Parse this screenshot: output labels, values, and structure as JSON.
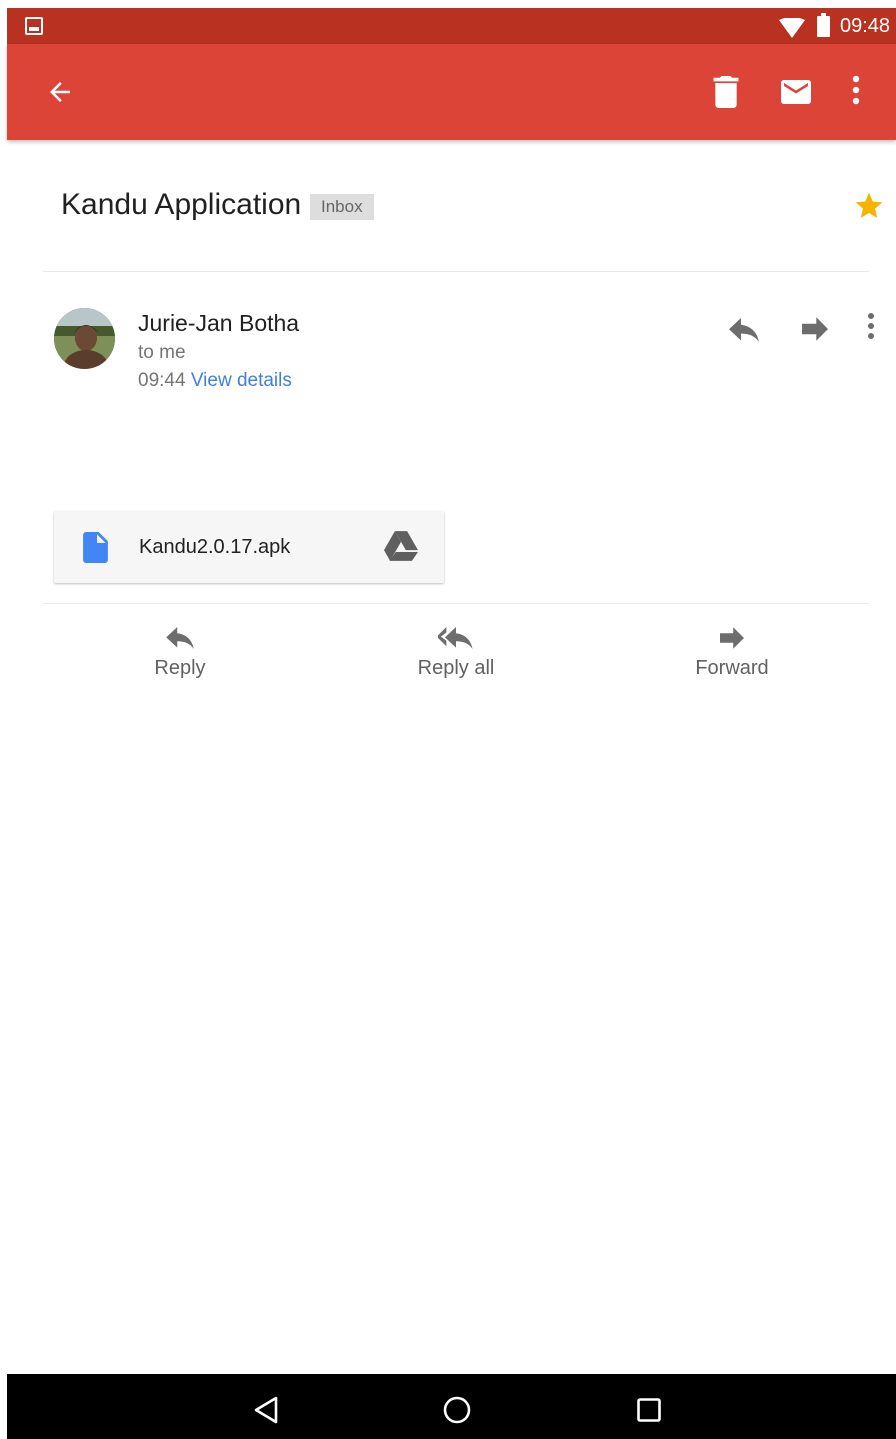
{
  "status_bar": {
    "time": "09:48"
  },
  "email": {
    "subject": "Kandu Application",
    "label": "Inbox",
    "sender_name": "Jurie-Jan Botha",
    "recipient_line": "to me",
    "time": "09:44",
    "view_details": "View details"
  },
  "attachment": {
    "file_name": "Kandu2.0.17.apk"
  },
  "actions": {
    "reply": "Reply",
    "reply_all": "Reply all",
    "forward": "Forward"
  },
  "colors": {
    "status_bar": "#b93221",
    "toolbar": "#db4437",
    "star": "#f4b400",
    "link": "#3e7fe0",
    "file_icon": "#4285f4"
  }
}
